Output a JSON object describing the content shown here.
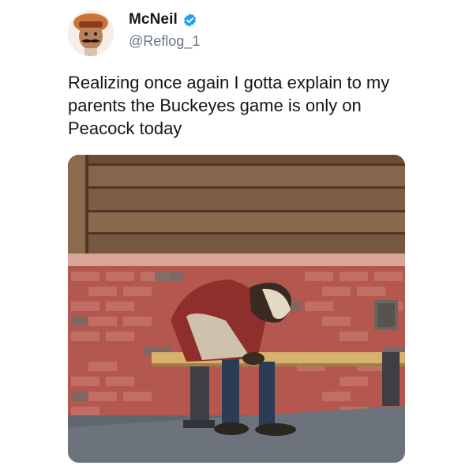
{
  "author": {
    "display_name": "McNeil",
    "handle": "@Reflog_1",
    "verified": true,
    "avatar_icon": "cartoon-mustache-man-avatar"
  },
  "tweet": {
    "text": "Realizing once again I gotta explain to my parents the Buckeyes game is only on Peacock today"
  },
  "media": {
    "kind": "photo",
    "icon": "man-head-down-on-bench-photo"
  },
  "colors": {
    "name": "#14171a",
    "handle": "#657786",
    "verified": "#1da1f2"
  }
}
